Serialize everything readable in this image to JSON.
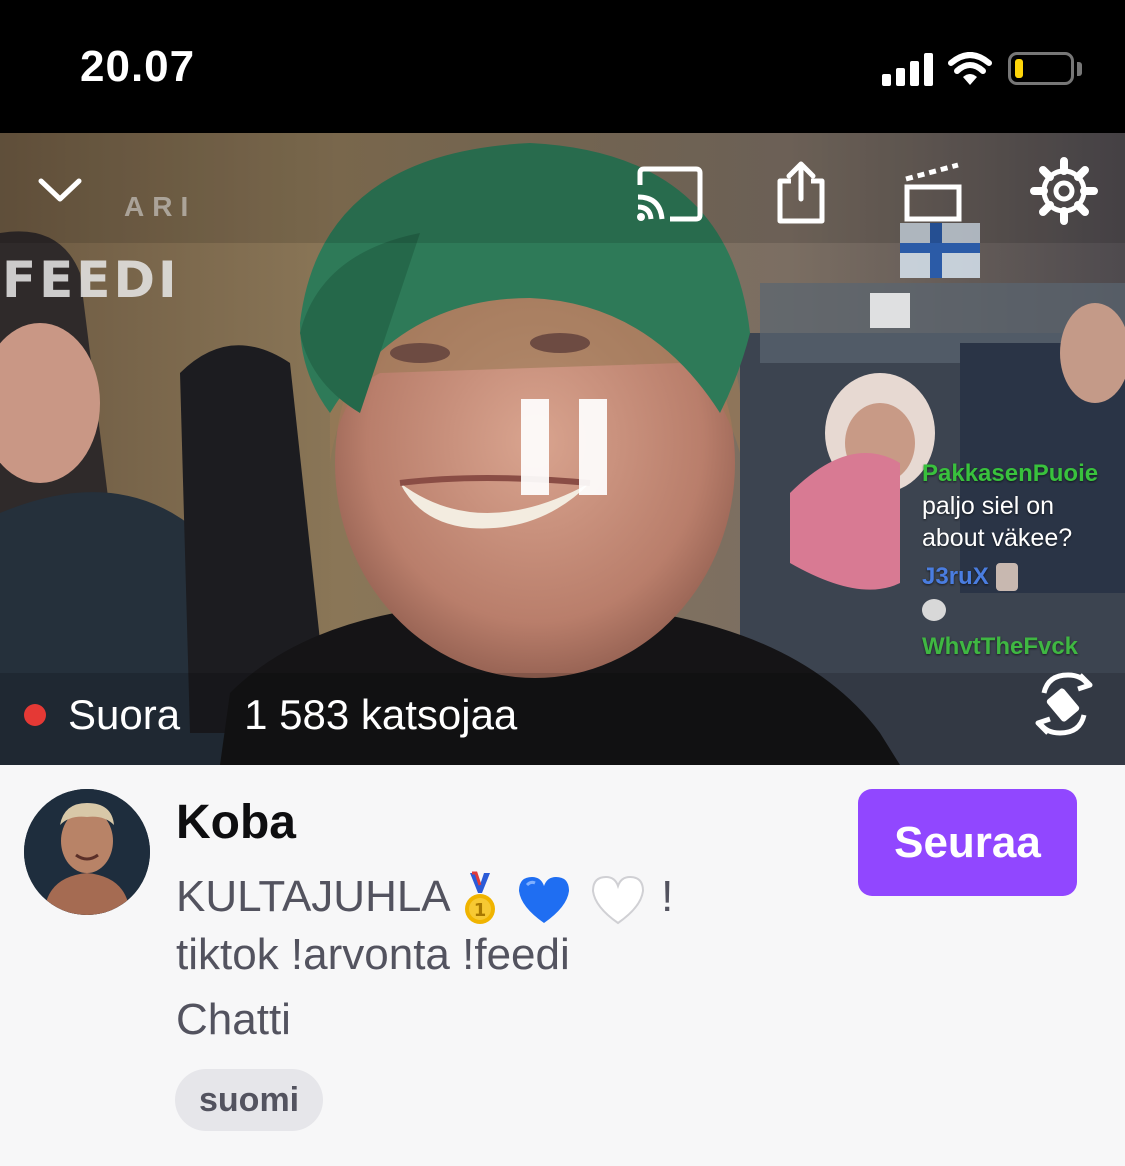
{
  "status_bar": {
    "time": "20.07",
    "battery_level": 0.15,
    "colors": {
      "battery_fill": "#ffd60a"
    }
  },
  "video": {
    "controls": {
      "collapse": "chevron-down-icon",
      "cast": "cast-icon",
      "share": "share-icon",
      "clip": "clip-icon",
      "settings": "gear-icon",
      "rotate": "rotate-icon",
      "pause": "pause-icon"
    },
    "overlay_logo": "FEEDI",
    "overlay_logo_small": "ARI",
    "chat_overlay": [
      {
        "user": "PakkasenPuoie",
        "message": "paljo siel on about väkee?"
      },
      {
        "user": "J3ruX",
        "message": ""
      },
      {
        "user": "WhvtTheFvck",
        "message": ""
      }
    ],
    "live_label": "Suora",
    "viewer_count": "1 583 katsojaa"
  },
  "channel": {
    "name": "Koba",
    "title": "KULTAJUHLA 🥇 💙 🤍 ! tiktok !arvonta !feedi",
    "title_line1_text": "KULTAJUHLA",
    "title_line1_end": "!",
    "title_line2": "tiktok !arvonta !feedi",
    "category": "Chatti",
    "tag": "suomi",
    "follow_label": "Seuraa",
    "colors": {
      "accent": "#9147ff",
      "live_dot": "#e53935"
    }
  }
}
